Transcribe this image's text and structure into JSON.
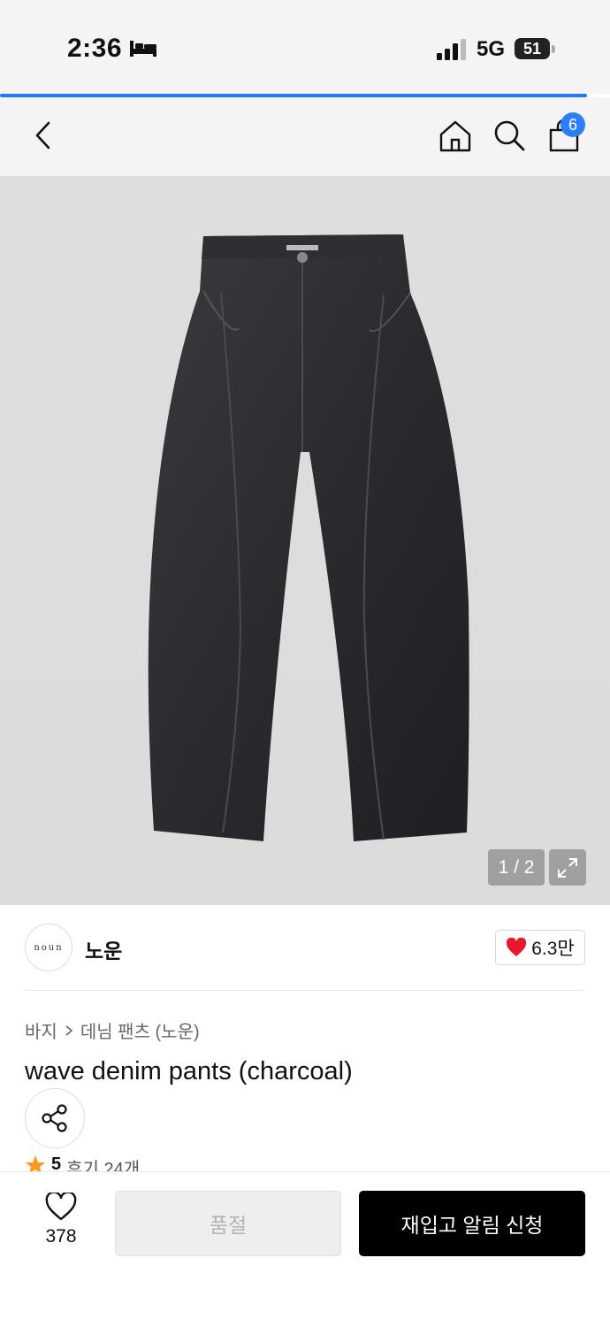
{
  "status_bar": {
    "time": "2:36",
    "network": "5G",
    "battery": "51",
    "icons": [
      "bed-icon",
      "signal-icon",
      "battery-icon"
    ]
  },
  "nav": {
    "icons": [
      "back-arrow-icon",
      "home-icon",
      "search-icon",
      "shopping-bag-icon"
    ],
    "cart_count": "6"
  },
  "product_image": {
    "counter": "1 / 2",
    "alt": "charcoal wave denim pants",
    "icons": [
      "expand-icon"
    ]
  },
  "brand": {
    "logo_text": "noun",
    "name": "노운",
    "likes": "6.3만",
    "like_color": "#e8192c"
  },
  "product": {
    "breadcrumb": [
      "바지",
      "데님 팬츠 (노운)"
    ],
    "title": "wave denim pants (charcoal)",
    "rating": "5",
    "reviews": "후기 24개",
    "star_color": "#f79a1f"
  },
  "bottom_bar": {
    "wish_count": "378",
    "soldout_label": "품절",
    "restock_label": "재입고 알림 신청"
  },
  "colors": {
    "accent": "#2d7ff9",
    "progress": "#1f7cf0",
    "primary_button": "#000000"
  }
}
